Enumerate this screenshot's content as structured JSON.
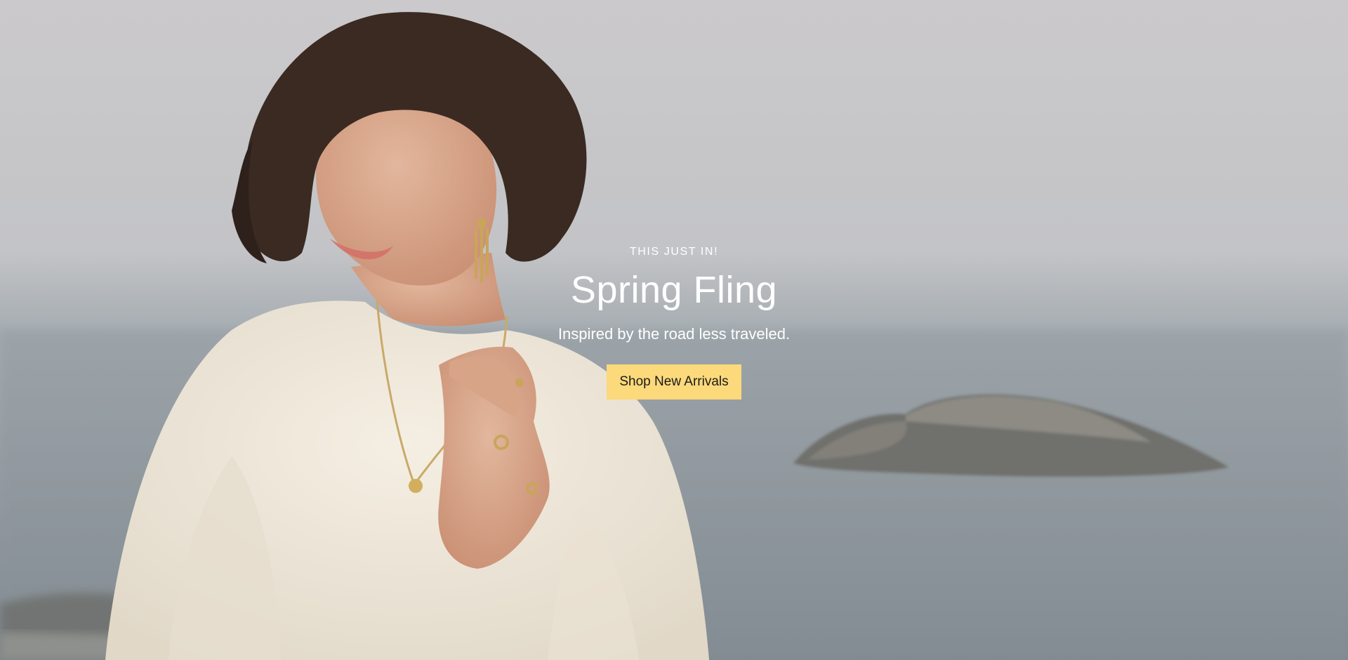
{
  "hero": {
    "eyebrow": "THIS JUST IN!",
    "title": "Spring Fling",
    "subtitle": "Inspired by the road less traveled.",
    "cta_label": "Shop New Arrivals",
    "cta_color": "#fcd97a",
    "text_color": "#ffffff"
  }
}
